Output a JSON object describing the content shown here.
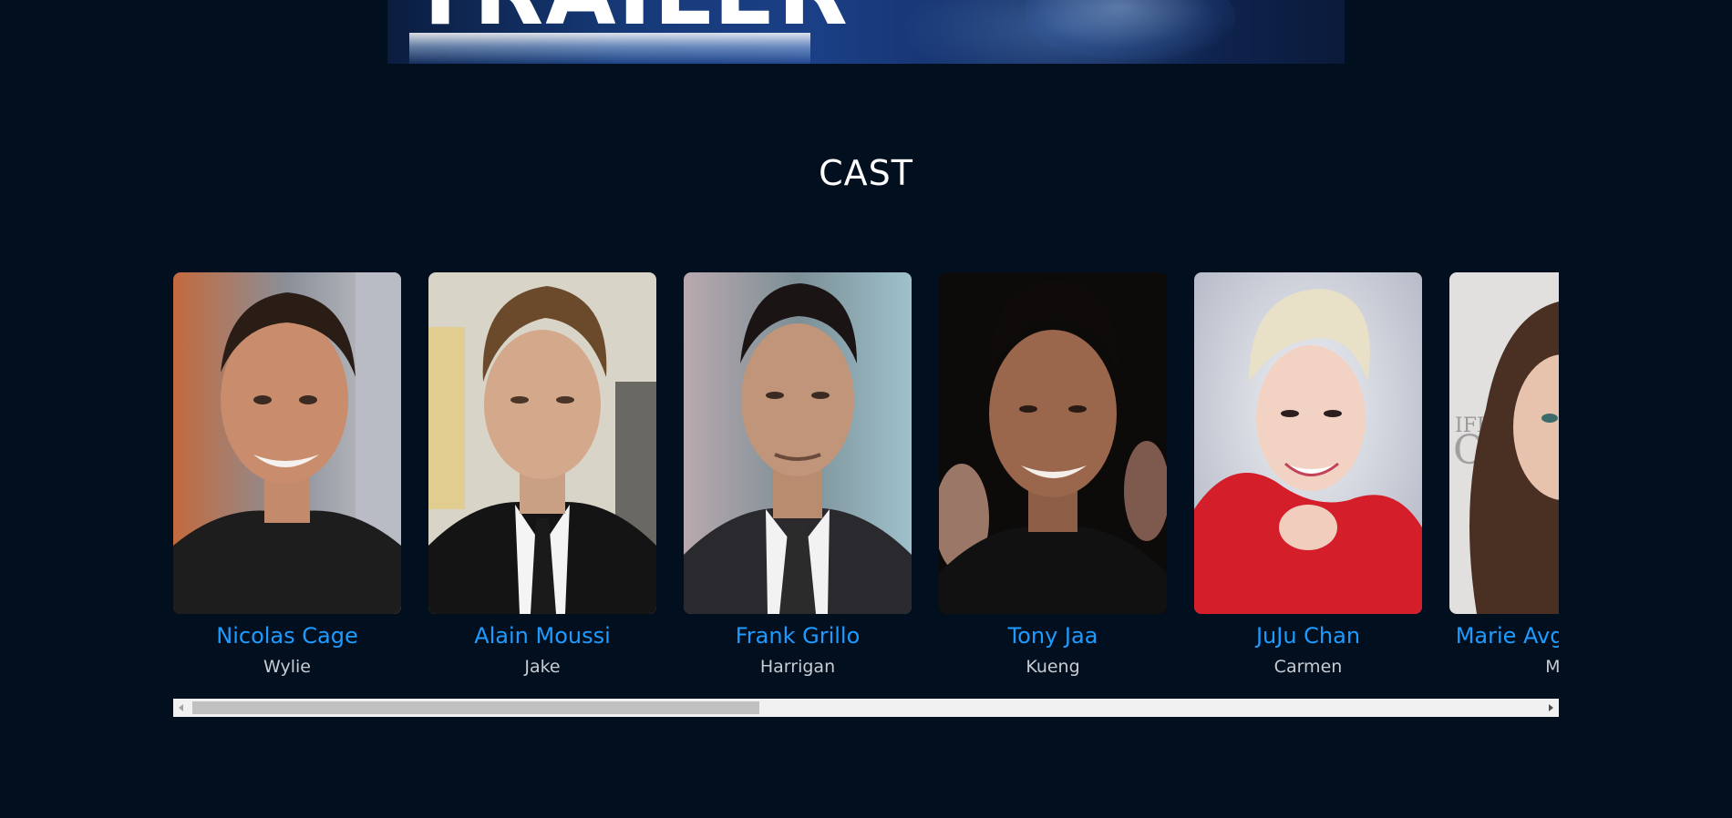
{
  "trailer": {
    "title": "TRAILER"
  },
  "cast_section": {
    "heading": "CAST",
    "members": [
      {
        "actor": "Nicolas Cage",
        "character": "Wylie"
      },
      {
        "actor": "Alain Moussi",
        "character": "Jake"
      },
      {
        "actor": "Frank Grillo",
        "character": "Harrigan"
      },
      {
        "actor": "Tony Jaa",
        "character": "Kueng"
      },
      {
        "actor": "JuJu Chan",
        "character": "Carmen"
      },
      {
        "actor": "Marie Avgeropoulos",
        "character": "Mae"
      }
    ]
  },
  "colors": {
    "background": "#020f1f",
    "actor_link": "#1e9bff",
    "character_text": "#c8ccd2",
    "heading": "#ffffff"
  }
}
